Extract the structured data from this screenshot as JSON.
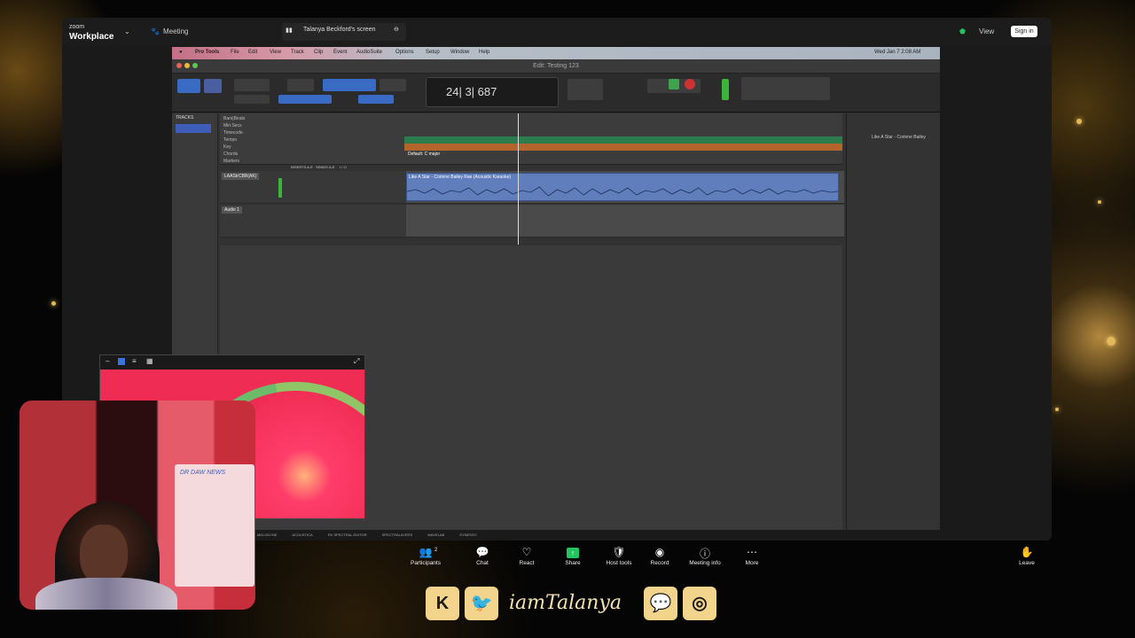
{
  "zoom": {
    "brand_small": "zoom",
    "brand_big": "Workplace",
    "meeting_label": "Meeting",
    "sharing_label": "Talanya Beckford's screen",
    "view_label": "View",
    "signin_label": "Sign in",
    "controls": [
      {
        "label": "Participants",
        "icon": "👥",
        "name": "participants-button",
        "count": "2"
      },
      {
        "label": "Chat",
        "icon": "💬",
        "name": "chat-button"
      },
      {
        "label": "React",
        "icon": "♡",
        "name": "react-button"
      },
      {
        "label": "Share",
        "icon": "↑",
        "name": "share-button"
      },
      {
        "label": "Host tools",
        "icon": "🛡",
        "name": "host-tools-button"
      },
      {
        "label": "Record",
        "icon": "◉",
        "name": "record-button"
      },
      {
        "label": "Meeting info",
        "icon": "ⓘ",
        "name": "meeting-info-button"
      },
      {
        "label": "More",
        "icon": "⋯",
        "name": "more-button"
      }
    ],
    "leave_label": "Leave",
    "leave_icon": "✋"
  },
  "mac_menu": {
    "items": [
      "Pro Tools",
      "File",
      "Edit",
      "View",
      "Track",
      "Clip",
      "Event",
      "AudioSuite",
      "Options",
      "Setup",
      "Window",
      "Help"
    ],
    "clock": "Wed Jan 7  2:08 AM"
  },
  "protools": {
    "window_title": "Edit: Testing 123",
    "counter_main": "24| 3| 687",
    "tracks_label": "TRACKS",
    "rulers": [
      "Bars|Beats",
      "Min:Secs",
      "Timecode",
      "Tempo",
      "Key",
      "Chords",
      "Markers"
    ],
    "tempo_label": "120",
    "key_label": "Default: C major",
    "track1_name": "LAAStrCBR(AK)",
    "track2_name": "Audio 1",
    "clip_name": "Like A Star - Corinne Bailey Rae (Acoustic Karaoke)",
    "cliplist_item": "Like A Star - Corinne Bailey",
    "column_inserts": "INSERTS A-E",
    "column_sends": "SENDS A-E",
    "column_io": "I / O",
    "dock_items": [
      "MELODYNE",
      "ACOUSTICA",
      "RX SPECTRAL EDITOR",
      "SPECTRALAYERS",
      "WAVELAB",
      "SYNESIS?"
    ]
  },
  "cam": {
    "board_text": "DR DAW NEWS"
  },
  "footer": {
    "handle": "iamTalanya",
    "social": [
      {
        "name": "kick-icon",
        "glyph": "K"
      },
      {
        "name": "twitter-icon",
        "glyph": "🐦"
      },
      {
        "name": "twitch-icon",
        "glyph": "💬"
      },
      {
        "name": "instagram-icon",
        "glyph": "◎"
      }
    ]
  },
  "colors": {
    "accent_green": "#22c55e",
    "clip_blue": "#5f7ebb",
    "tempo_green": "#2c7c4f",
    "key_orange": "#b3652c"
  }
}
